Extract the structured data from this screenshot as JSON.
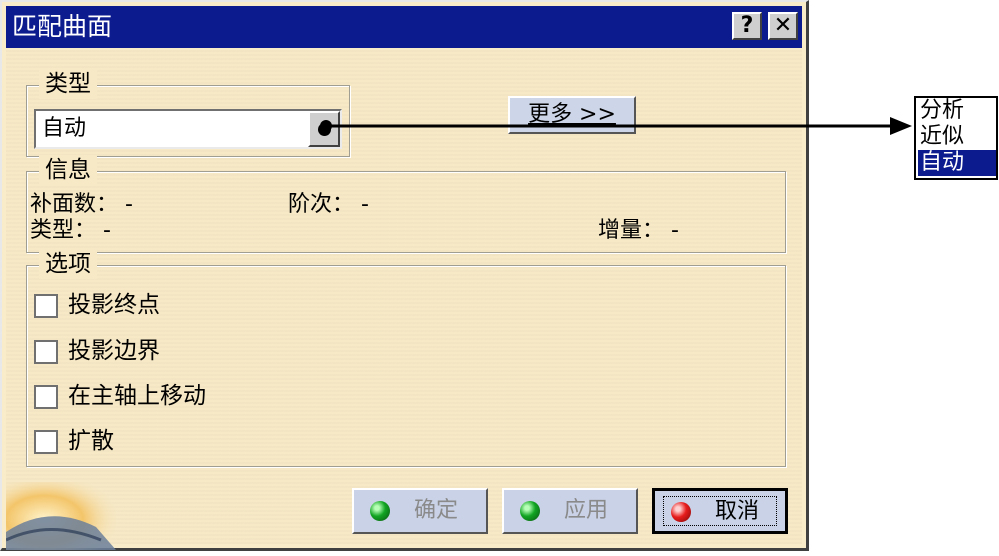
{
  "dialog": {
    "title": "匹配曲面",
    "help_label": "?",
    "close_label": "✕"
  },
  "type_group": {
    "legend": "类型",
    "combo_value": "自动"
  },
  "more_button": "更多 >>",
  "info_group": {
    "legend": "信息",
    "patch_count": "补面数： -",
    "order": "阶次： -",
    "type": "类型： -",
    "increment": "增量： -"
  },
  "options_group": {
    "legend": "选项",
    "items": [
      {
        "label": "投影终点",
        "checked": false
      },
      {
        "label": "投影边界",
        "checked": false
      },
      {
        "label": "在主轴上移动",
        "checked": false
      },
      {
        "label": "扩散",
        "checked": false
      }
    ]
  },
  "actions": {
    "ok": "确定",
    "apply": "应用",
    "cancel": "取消"
  },
  "dropdown_list": {
    "items": [
      "分析",
      "近似",
      "自动"
    ],
    "selected": "自动"
  },
  "colors": {
    "title_bar": "#0c1b8e",
    "dialog_bg": "#f7e9c6",
    "button_bg": "#c9d2e6",
    "ok_led": "#11a522",
    "cancel_led": "#e81c1c"
  },
  "icons": [
    "help-icon",
    "close-icon",
    "dropdown-arrow-icon",
    "ok-led-icon",
    "apply-led-icon",
    "cancel-led-icon"
  ]
}
